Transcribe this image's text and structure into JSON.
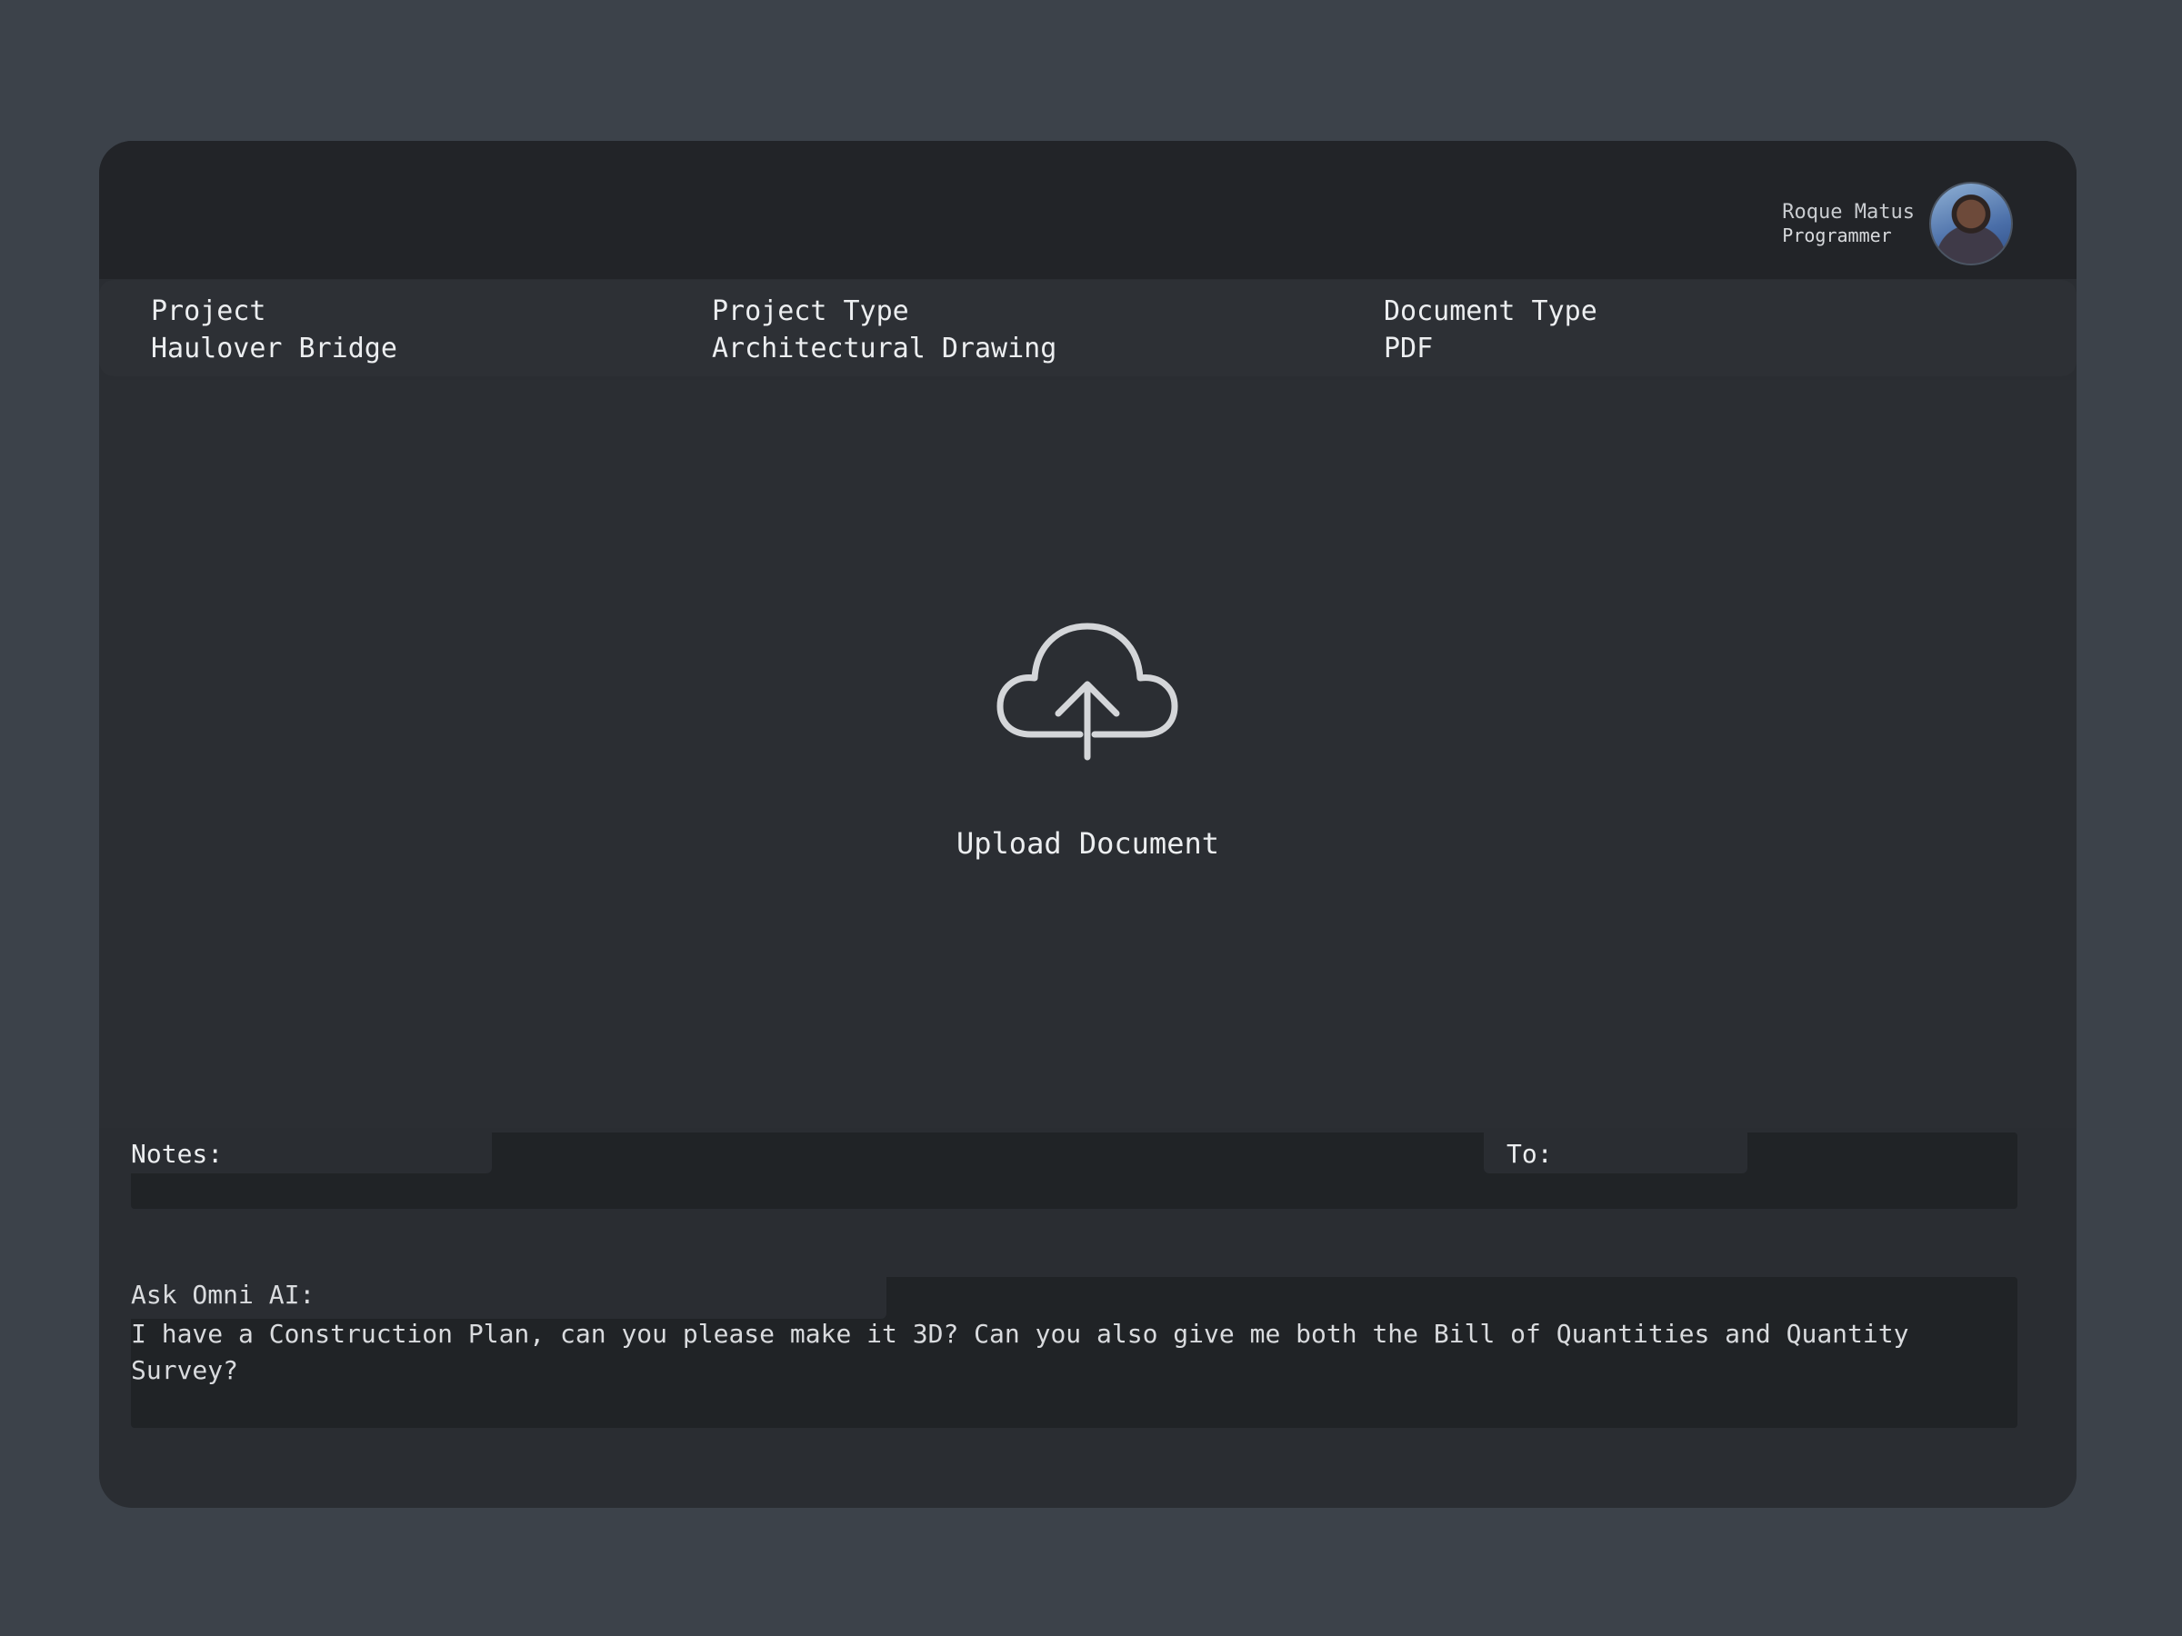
{
  "user": {
    "name": "Roque Matus",
    "role": "Programmer"
  },
  "info": {
    "project_label": "Project",
    "project_value": "Haulover Bridge",
    "project_type_label": "Project Type",
    "project_type_value": "Architectural Drawing",
    "document_type_label": "Document Type",
    "document_type_value": "PDF"
  },
  "upload": {
    "icon": "cloud-upload-icon",
    "label": "Upload Document"
  },
  "notes": {
    "label": "Notes:",
    "to_label": "To:"
  },
  "ask": {
    "label": "Ask Omni AI:",
    "value": "I have a Construction Plan, can you please make it 3D? Can you also give me both the Bill of Quantities and Quantity Survey?"
  }
}
